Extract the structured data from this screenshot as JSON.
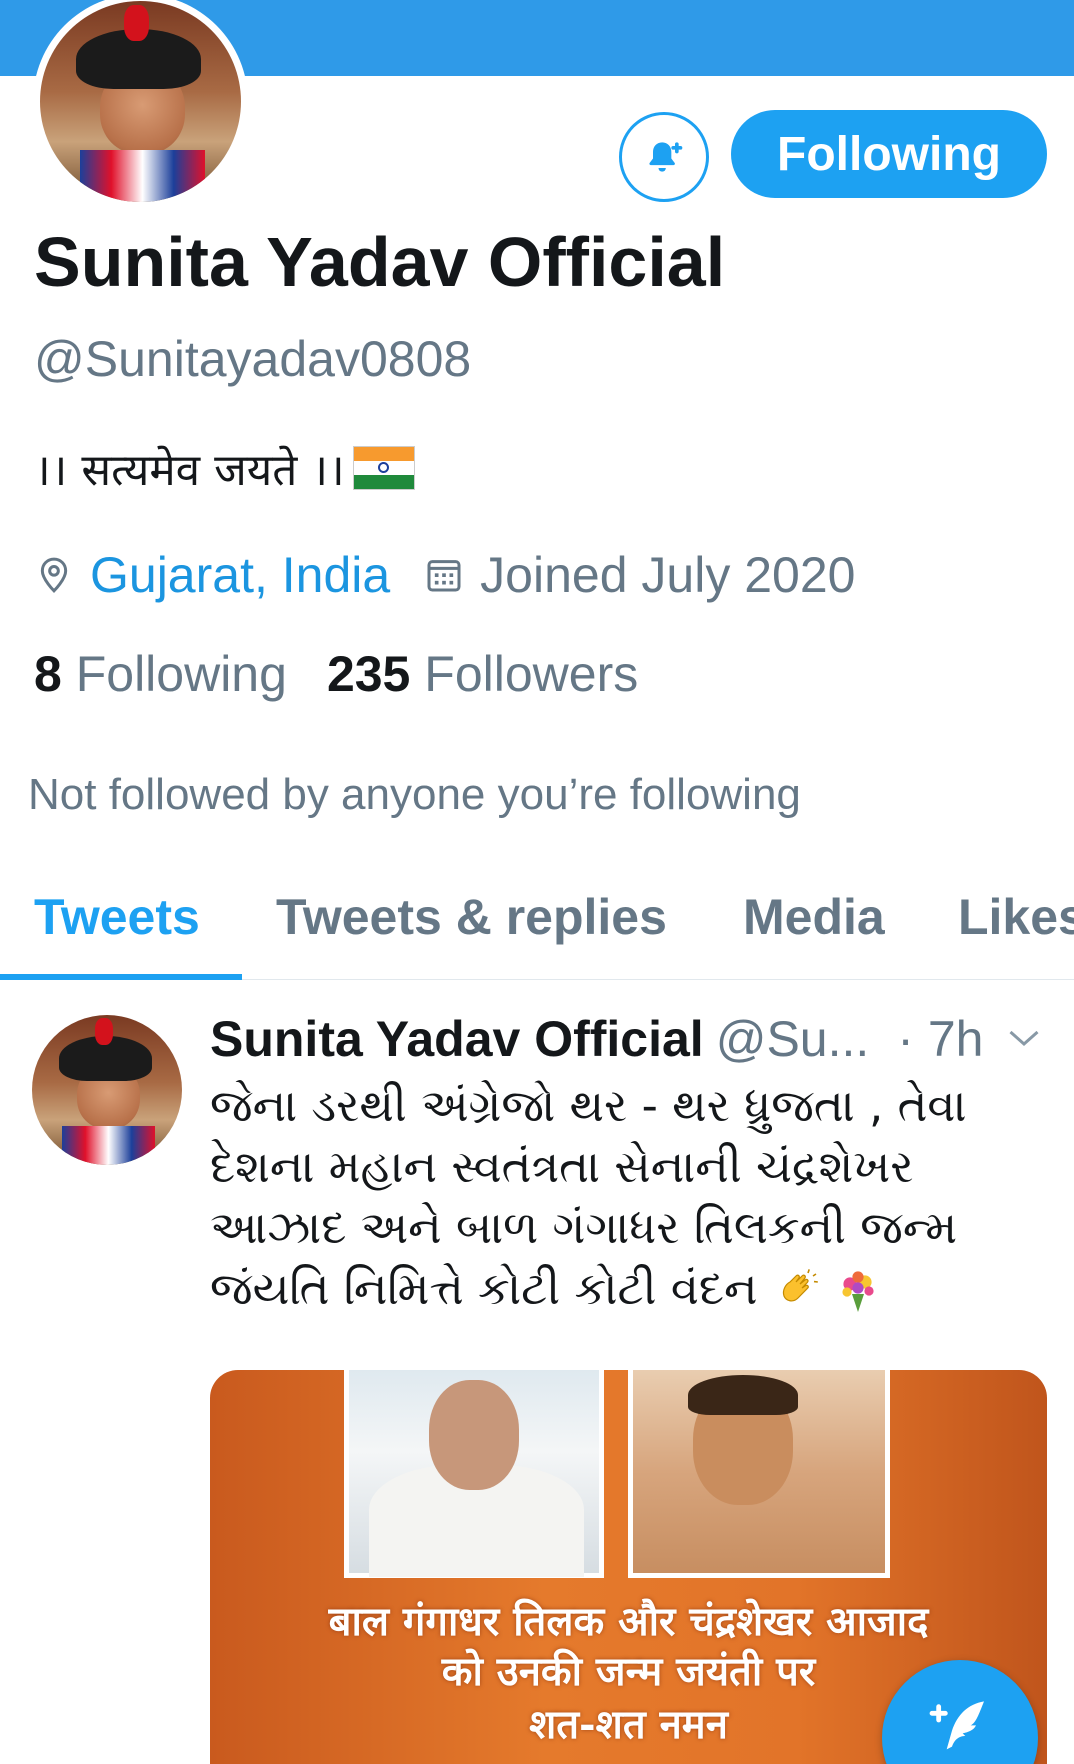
{
  "profile": {
    "follow_button": "Following",
    "name": "Sunita Yadav Official",
    "handle": "@Sunitayadav0808",
    "bio": "।। सत्यमेव जयते ।।",
    "location": "Gujarat, India",
    "joined": "Joined July 2020",
    "following_count": "8",
    "following_label": "Following",
    "followers_count": "235",
    "followers_label": "Followers",
    "not_followed": "Not followed by anyone you’re following",
    "icons": {
      "bell": "bell-plus-icon",
      "location": "location-pin-icon",
      "calendar": "calendar-icon",
      "flag": "india-flag-emoji"
    }
  },
  "tabs": [
    {
      "label": "Tweets",
      "active": true
    },
    {
      "label": "Tweets & replies",
      "active": false
    },
    {
      "label": "Media",
      "active": false
    },
    {
      "label": "Likes",
      "active": false
    }
  ],
  "tweet": {
    "name": "Sunita Yadav Official",
    "handle": "@Su...",
    "time": "· 7h",
    "text_lines": [
      "જેના ડરથી અંગ્રેજો થર - થર ધ્રુજતા , તેવા",
      "દેશના મહાન સ્વતંત્રતા સેનાની ચંદ્રશેખર",
      "આઝાદ અને બાળ ગંગાધર તિલકની જન્મ",
      "જંયતિ નિમિત્તે કોટી કોટી વંદન"
    ],
    "emojis": [
      "clapping-hands-emoji",
      "bouquet-emoji"
    ],
    "media": {
      "line1": "बाल गंगाधर तिलक और चंद्रशेखर आजाद",
      "line2": "को उनकी जन्म जयंती पर",
      "line3": "शत-शत नमन"
    }
  },
  "fab": {
    "icon": "compose-tweet-icon",
    "label": "+"
  },
  "colors": {
    "accent": "#1da1f2",
    "banner": "#2f9ae8",
    "secondary_text": "#657786",
    "media_bg": "#e57a2c"
  }
}
